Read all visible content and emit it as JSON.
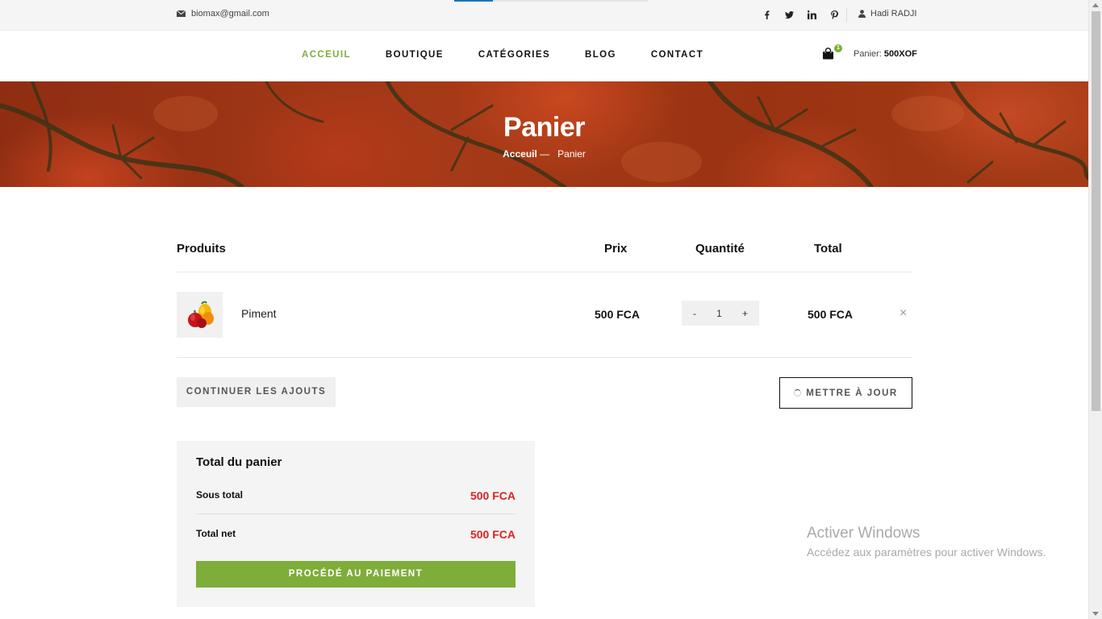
{
  "topbar": {
    "email": "biomax@gmail.com",
    "socials": [
      "facebook-icon",
      "twitter-icon",
      "linkedin-icon",
      "pinterest-icon"
    ],
    "user_name": "Hadi RADJI"
  },
  "header": {
    "nav": [
      "ACCEUIL",
      "BOUTIQUE",
      "CATÉGORIES",
      "BLOG",
      "CONTACT"
    ],
    "active_nav": "ACCEUIL",
    "cart_count": "1",
    "cart_label": "Panier:",
    "cart_amount": "500XOF"
  },
  "hero": {
    "title": "Panier",
    "breadcrumb_home": "Acceuil",
    "breadcrumb_separator": "—",
    "breadcrumb_current": "Panier"
  },
  "cart": {
    "headers": {
      "product": "Produits",
      "price": "Prix",
      "quantity": "Quantité",
      "total": "Total"
    },
    "items": [
      {
        "name": "Piment",
        "price": "500 FCA",
        "quantity": "1",
        "total": "500 FCA"
      }
    ],
    "qty_minus": "-",
    "qty_plus": "+",
    "remove": "×"
  },
  "buttons": {
    "continue": "CONTINUER LES AJOUTS",
    "update": "METTRE À JOUR"
  },
  "totals": {
    "title": "Total du panier",
    "subtotal_label": "Sous total",
    "subtotal_value": "500 FCA",
    "net_label": "Total net",
    "net_value": "500 FCA",
    "checkout": "PROCÉDÉ AU PAIEMENT"
  },
  "watermark": {
    "title": "Activer Windows",
    "subtitle": "Accédez aux paramètres pour activer Windows."
  },
  "colors": {
    "accent": "#7fad39",
    "price_red": "#dd2222"
  }
}
